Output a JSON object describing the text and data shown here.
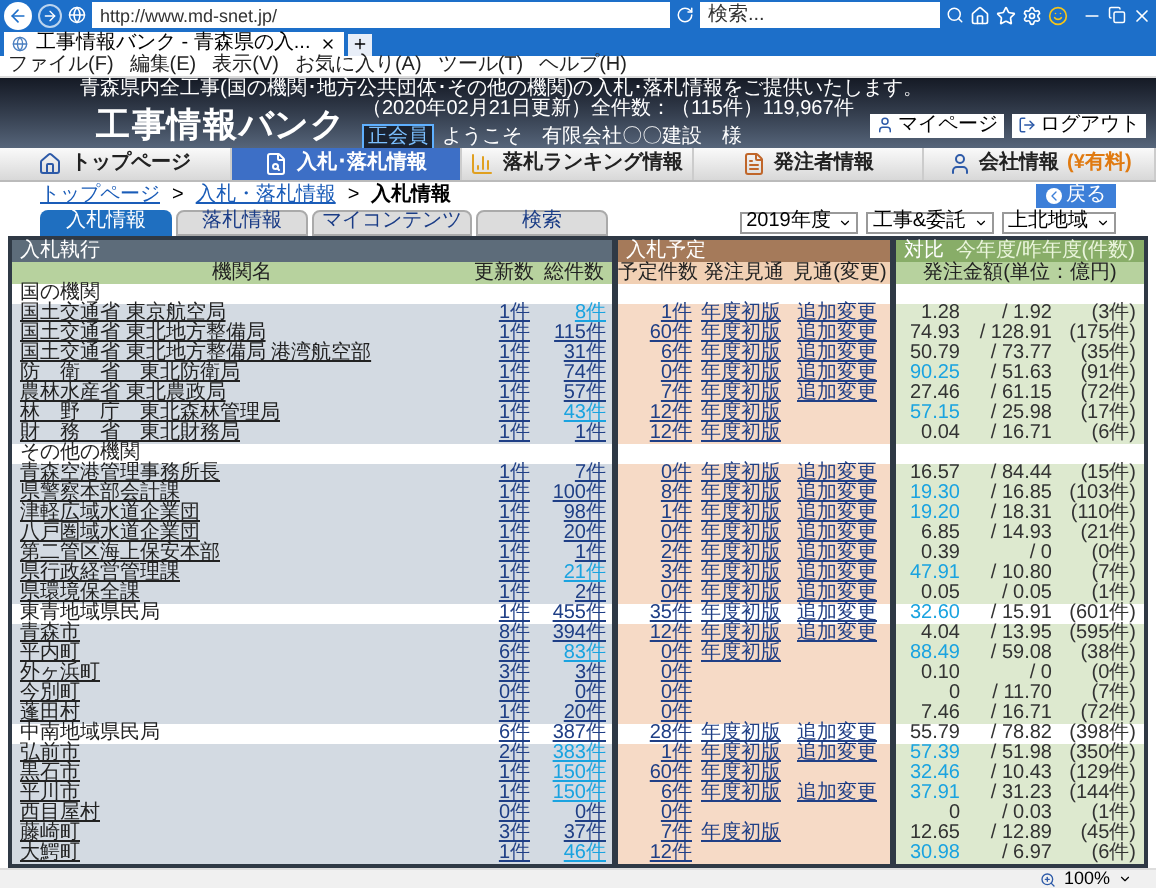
{
  "browser": {
    "address": "http://www.md-snet.jp/",
    "search_placeholder": "検索...",
    "tab_title": "工事情報バンク - 青森県の入...",
    "menu": [
      "ファイル(F)",
      "編集(E)",
      "表示(V)",
      "お気に入り(A)",
      "ツール(T)",
      "ヘルプ(H)"
    ],
    "zoom": "100%"
  },
  "header": {
    "tagline": "青森県内全工事(国の機関･地方公共団体･その他の機関)の入札･落札情報をご提供いたします。",
    "update_info": "（2020年02月21日更新）全件数：（115件）119,967件",
    "logo": "工事情報バンク",
    "member_badge": "正会員",
    "welcome": "ようこそ　有限会社〇〇建設　様",
    "buttons": [
      {
        "kind": "mypage",
        "label": "マイページ"
      },
      {
        "kind": "logout",
        "label": "ログアウト"
      }
    ]
  },
  "nav": [
    {
      "kind": "home",
      "label": "トップページ",
      "selected": false
    },
    {
      "kind": "bids",
      "label": "入札･落札情報",
      "selected": true
    },
    {
      "kind": "ranking",
      "label": "落札ランキング情報",
      "selected": false
    },
    {
      "kind": "orderer",
      "label": "発注者情報",
      "selected": false
    },
    {
      "kind": "company",
      "label": "会社情報",
      "badge": "(¥有料)",
      "selected": false
    }
  ],
  "breadcrumb": [
    {
      "kind": "link",
      "text": "トップページ"
    },
    {
      "kind": "separator",
      "text": ">"
    },
    {
      "kind": "link",
      "text": "入札・落札情報"
    },
    {
      "kind": "separator",
      "text": ">"
    },
    {
      "kind": "current",
      "text": "入札情報"
    }
  ],
  "back_button": "戻る",
  "tabs": [
    {
      "label": "入札情報",
      "selected": true
    },
    {
      "label": "落札情報",
      "selected": false
    },
    {
      "label": "マイコンテンツ",
      "selected": false
    },
    {
      "label": "検索",
      "selected": false
    }
  ],
  "filters": [
    "2019年度",
    "工事&委託",
    "上北地域"
  ],
  "table": {
    "panels": [
      {
        "title": "入札執行",
        "columns": [
          "機関名",
          "更新数",
          "総件数"
        ]
      },
      {
        "title": "入札予定",
        "columns": [
          "予定件数",
          "発注見通",
          "見通(変更)"
        ]
      },
      {
        "title": "対比",
        "subtitle": "今年度/昨年度(件数)",
        "columns": [
          "発注金額(単位：億円)"
        ]
      }
    ],
    "sections": [
      {
        "kind": "heading",
        "name": "国の機関",
        "rows": [
          {
            "name": "国土交通省 東京航空局",
            "updates": "1件",
            "total": "8件",
            "total_new": true,
            "planned": "1件",
            "outlook": "年度初版",
            "outlook_change": "追加変更",
            "amount_this": "1.28",
            "amount_up": false,
            "amount_last": "/ 1.92",
            "amount_count": "(3件)"
          },
          {
            "name": "国土交通省 東北地方整備局",
            "updates": "1件",
            "total": "115件",
            "total_new": false,
            "planned": "60件",
            "outlook": "年度初版",
            "outlook_change": "追加変更",
            "amount_this": "74.93",
            "amount_up": false,
            "amount_last": "/ 128.91",
            "amount_count": "(175件)"
          },
          {
            "name": "国土交通省 東北地方整備局 港湾航空部",
            "updates": "1件",
            "total": "31件",
            "total_new": false,
            "planned": "6件",
            "outlook": "年度初版",
            "outlook_change": "追加変更",
            "amount_this": "50.79",
            "amount_up": false,
            "amount_last": "/ 73.77",
            "amount_count": "(35件)"
          },
          {
            "name": "防　衛　省　東北防衛局",
            "updates": "1件",
            "total": "74件",
            "total_new": false,
            "planned": "0件",
            "outlook": "年度初版",
            "outlook_change": "追加変更",
            "amount_this": "90.25",
            "amount_up": true,
            "amount_last": "/ 51.63",
            "amount_count": "(91件)"
          },
          {
            "name": "農林水産省 東北農政局",
            "updates": "1件",
            "total": "57件",
            "total_new": false,
            "planned": "7件",
            "outlook": "年度初版",
            "outlook_change": "追加変更",
            "amount_this": "27.46",
            "amount_up": false,
            "amount_last": "/ 61.15",
            "amount_count": "(72件)"
          },
          {
            "name": "林　野　庁　東北森林管理局",
            "updates": "1件",
            "total": "43件",
            "total_new": true,
            "planned": "12件",
            "outlook": "年度初版",
            "amount_this": "57.15",
            "amount_up": true,
            "amount_last": "/ 25.98",
            "amount_count": "(17件)"
          },
          {
            "name": "財　務　省　東北財務局",
            "updates": "1件",
            "total": "1件",
            "total_new": false,
            "planned": "12件",
            "outlook": "年度初版",
            "amount_this": "0.04",
            "amount_up": false,
            "amount_last": "/ 16.71",
            "amount_count": "(6件)"
          }
        ]
      },
      {
        "kind": "heading",
        "name": "その他の機関",
        "rows": [
          {
            "name": "青森空港管理事務所長",
            "updates": "1件",
            "total": "7件",
            "total_new": false,
            "planned": "0件",
            "outlook": "年度初版",
            "outlook_change": "追加変更",
            "amount_this": "16.57",
            "amount_up": false,
            "amount_last": "/ 84.44",
            "amount_count": "(15件)"
          },
          {
            "name": "県警察本部会計課",
            "updates": "1件",
            "total": "100件",
            "total_new": false,
            "planned": "8件",
            "outlook": "年度初版",
            "outlook_change": "追加変更",
            "amount_this": "19.30",
            "amount_up": true,
            "amount_last": "/ 16.85",
            "amount_count": "(103件)"
          },
          {
            "name": "津軽広域水道企業団",
            "updates": "1件",
            "total": "98件",
            "total_new": false,
            "planned": "1件",
            "outlook": "年度初版",
            "outlook_change": "追加変更",
            "amount_this": "19.20",
            "amount_up": true,
            "amount_last": "/ 18.31",
            "amount_count": "(110件)"
          },
          {
            "name": "八戸圏域水道企業団",
            "updates": "1件",
            "total": "20件",
            "total_new": false,
            "planned": "0件",
            "outlook": "年度初版",
            "outlook_change": "追加変更",
            "amount_this": "6.85",
            "amount_up": false,
            "amount_last": "/ 14.93",
            "amount_count": "(21件)"
          },
          {
            "name": "第二管区海上保安本部",
            "updates": "1件",
            "total": "1件",
            "total_new": false,
            "planned": "2件",
            "outlook": "年度初版",
            "outlook_change": "追加変更",
            "amount_this": "0.39",
            "amount_up": false,
            "amount_last": "/ 0",
            "amount_count": "(0件)"
          },
          {
            "name": "県行政経営管理課",
            "updates": "1件",
            "total": "21件",
            "total_new": true,
            "planned": "3件",
            "outlook": "年度初版",
            "outlook_change": "追加変更",
            "amount_this": "47.91",
            "amount_up": true,
            "amount_last": "/ 10.80",
            "amount_count": "(7件)"
          },
          {
            "name": "県環境保全課",
            "updates": "1件",
            "total": "2件",
            "total_new": false,
            "planned": "0件",
            "outlook": "年度初版",
            "outlook_change": "追加変更",
            "amount_this": "0.05",
            "amount_up": false,
            "amount_last": "/ 0.05",
            "amount_count": "(1件)"
          }
        ]
      },
      {
        "kind": "summary",
        "name": "東青地域県民局",
        "updates": "1件",
        "total": "455件",
        "total_new": false,
        "planned": "35件",
        "outlook": "年度初版",
        "outlook_change": "追加変更",
        "amount_this": "32.60",
        "amount_up": true,
        "amount_last": "/ 15.91",
        "amount_count": "(601件)",
        "rows": [
          {
            "name": "青森市",
            "updates": "8件",
            "total": "394件",
            "total_new": false,
            "planned": "12件",
            "outlook": "年度初版",
            "outlook_change": "追加変更",
            "amount_this": "4.04",
            "amount_up": false,
            "amount_last": "/ 13.95",
            "amount_count": "(595件)"
          },
          {
            "name": "平内町",
            "updates": "6件",
            "total": "83件",
            "total_new": true,
            "planned": "0件",
            "outlook": "年度初版",
            "amount_this": "88.49",
            "amount_up": true,
            "amount_last": "/ 59.08",
            "amount_count": "(38件)"
          },
          {
            "name": "外ヶ浜町",
            "updates": "3件",
            "total": "3件",
            "total_new": false,
            "planned": "0件",
            "amount_this": "0.10",
            "amount_up": false,
            "amount_last": "/ 0",
            "amount_count": "(0件)"
          },
          {
            "name": "今別町",
            "updates": "0件",
            "total": "0件",
            "total_new": false,
            "planned": "0件",
            "amount_this": "0",
            "amount_up": false,
            "amount_last": "/ 11.70",
            "amount_count": "(7件)"
          },
          {
            "name": "蓬田村",
            "updates": "1件",
            "total": "20件",
            "total_new": false,
            "planned": "0件",
            "amount_this": "7.46",
            "amount_up": false,
            "amount_last": "/ 16.71",
            "amount_count": "(72件)"
          }
        ]
      },
      {
        "kind": "summary",
        "name": "中南地域県民局",
        "updates": "6件",
        "total": "387件",
        "total_new": false,
        "planned": "28件",
        "outlook": "年度初版",
        "outlook_change": "追加変更",
        "amount_this": "55.79",
        "amount_up": false,
        "amount_last": "/ 78.82",
        "amount_count": "(398件)",
        "rows": [
          {
            "name": "弘前市",
            "updates": "2件",
            "total": "383件",
            "total_new": true,
            "planned": "1件",
            "outlook": "年度初版",
            "outlook_change": "追加変更",
            "amount_this": "57.39",
            "amount_up": true,
            "amount_last": "/ 51.98",
            "amount_count": "(350件)"
          },
          {
            "name": "黒石市",
            "updates": "1件",
            "total": "150件",
            "total_new": true,
            "planned": "60件",
            "outlook": "年度初版",
            "amount_this": "32.46",
            "amount_up": true,
            "amount_last": "/ 10.43",
            "amount_count": "(129件)"
          },
          {
            "name": "平川市",
            "updates": "1件",
            "total": "150件",
            "total_new": true,
            "planned": "6件",
            "outlook": "年度初版",
            "outlook_change": "追加変更",
            "amount_this": "37.91",
            "amount_up": true,
            "amount_last": "/ 31.23",
            "amount_count": "(144件)"
          },
          {
            "name": "西目屋村",
            "updates": "0件",
            "total": "0件",
            "total_new": false,
            "planned": "0件",
            "amount_this": "0",
            "amount_up": false,
            "amount_last": "/ 0.03",
            "amount_count": "(1件)"
          },
          {
            "name": "藤崎町",
            "updates": "3件",
            "total": "37件",
            "total_new": false,
            "planned": "7件",
            "outlook": "年度初版",
            "amount_this": "12.65",
            "amount_up": false,
            "amount_last": "/ 12.89",
            "amount_count": "(45件)"
          },
          {
            "name": "大鰐町",
            "updates": "1件",
            "total": "46件",
            "total_new": true,
            "planned": "12件",
            "amount_this": "30.98",
            "amount_up": true,
            "amount_last": "/ 6.97",
            "amount_count": "(6件)"
          }
        ]
      }
    ]
  }
}
